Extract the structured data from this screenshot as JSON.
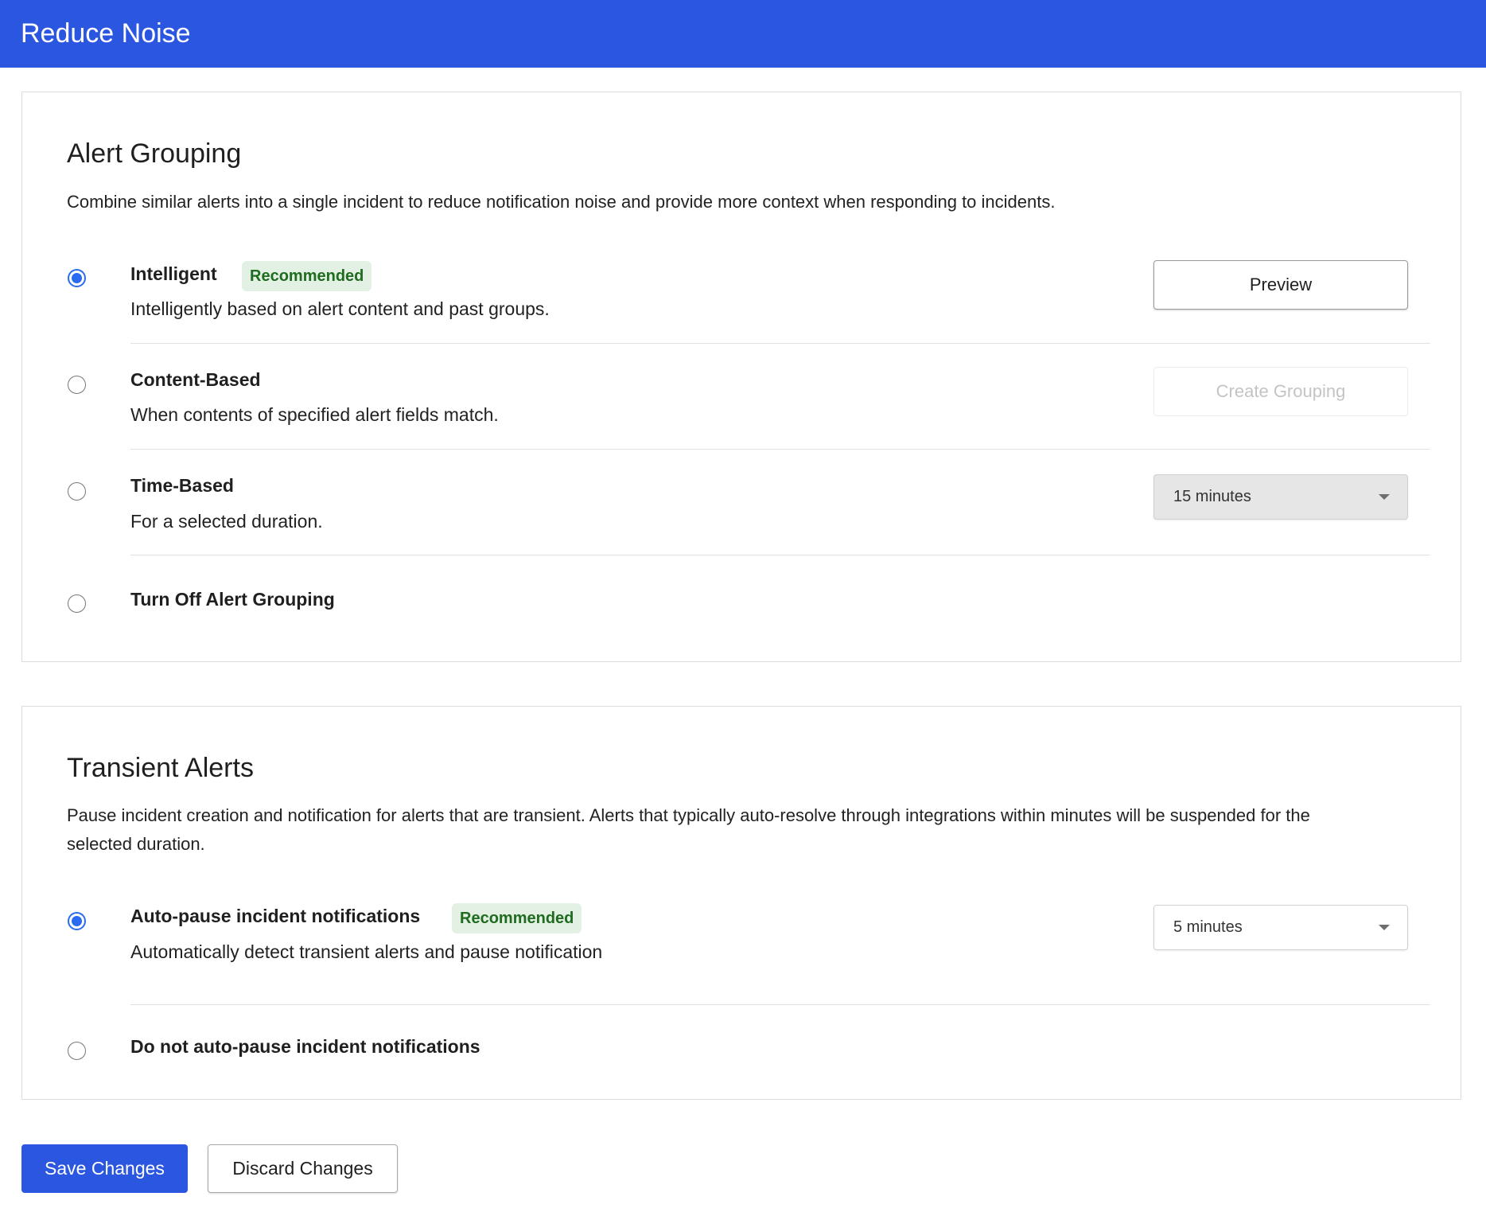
{
  "header": {
    "title": "Reduce Noise"
  },
  "alert_grouping": {
    "title": "Alert Grouping",
    "description": "Combine similar alerts into a single incident to reduce notification noise and provide more context when responding to incidents.",
    "options": [
      {
        "title": "Intelligent",
        "badge": "Recommended",
        "description": "Intelligently based on alert content and past groups.",
        "selected": true,
        "action_label": "Preview"
      },
      {
        "title": "Content-Based",
        "description": "When contents of specified alert fields match.",
        "selected": false,
        "action_label": "Create Grouping",
        "action_disabled": true
      },
      {
        "title": "Time-Based",
        "description": "For a selected duration.",
        "selected": false,
        "select_value": "15 minutes",
        "select_disabled": true
      },
      {
        "title": "Turn Off Alert Grouping",
        "selected": false
      }
    ]
  },
  "transient_alerts": {
    "title": "Transient Alerts",
    "description": "Pause incident creation and notification for alerts that are transient.  Alerts that typically auto-resolve through integrations within minutes will be suspended for the selected duration.",
    "options": [
      {
        "title": "Auto-pause incident notifications",
        "badge": "Recommended",
        "description": "Automatically detect transient alerts and pause notification",
        "selected": true,
        "select_value": "5 minutes"
      },
      {
        "title": "Do not auto-pause incident notifications",
        "selected": false
      }
    ]
  },
  "footer": {
    "save_label": "Save Changes",
    "discard_label": "Discard Changes"
  },
  "colors": {
    "brand": "#2b57e0",
    "radio_selected": "#2b6bf0",
    "badge_bg": "#e3f0e4",
    "badge_text": "#1f6b1f"
  }
}
